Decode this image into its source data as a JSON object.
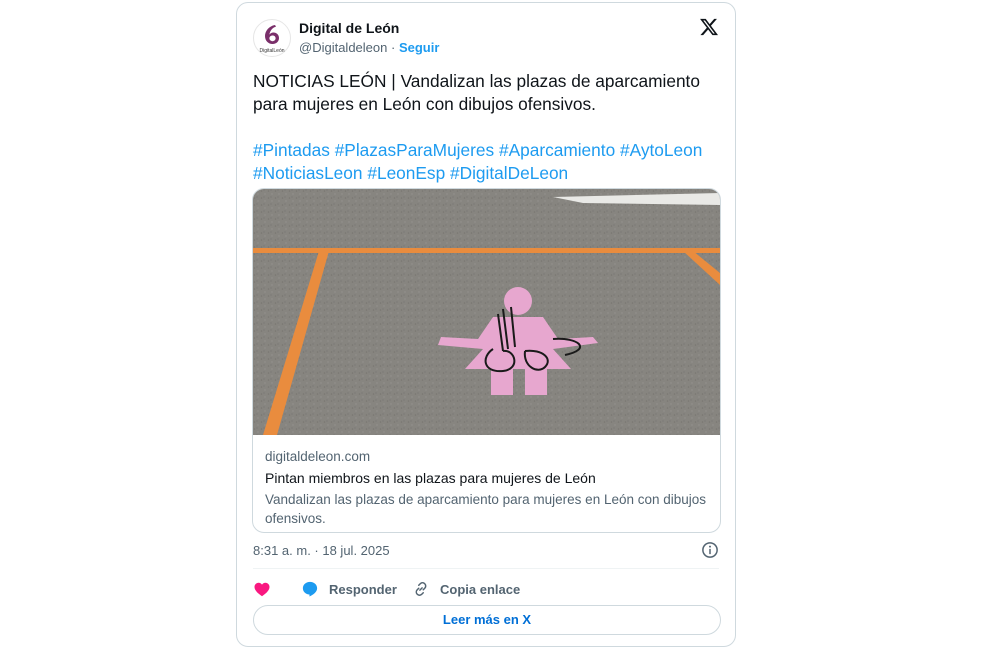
{
  "author": {
    "name": "Digital de León",
    "handle": "@Digitaldeleon",
    "separator": "·",
    "follow_label": "Seguir",
    "logo_caption": "DigitalLeón"
  },
  "tweet": {
    "text": "NOTICIAS LEÓN | Vandalizan las plazas de aparcamiento para mujeres en León con dibujos ofensivos.",
    "hashtags": [
      "#Pintadas",
      "#PlazasParaMujeres",
      "#Aparcamiento",
      "#AytoLeon",
      "#NoticiasLeon",
      "#LeonEsp",
      "#DigitalDeLeon"
    ]
  },
  "link_card": {
    "domain": "digitaldeleon.com",
    "title": "Pintan miembros en las plazas para mujeres de León",
    "description": "Vandalizan las plazas de aparcamiento para mujeres en León con dibujos ofensivos."
  },
  "meta": {
    "timestamp": "8:31 a. m. · 18 jul. 2025"
  },
  "actions": {
    "reply_label": "Responder",
    "copy_label": "Copia enlace",
    "read_more_label": "Leer más en X"
  },
  "colors": {
    "accent": "#1d9bf0",
    "like": "#f91880",
    "text_secondary": "#536471",
    "border": "#cfd9de"
  },
  "icons": [
    "x-logo-icon",
    "info-icon",
    "heart-icon",
    "reply-bubble-icon",
    "link-icon"
  ]
}
